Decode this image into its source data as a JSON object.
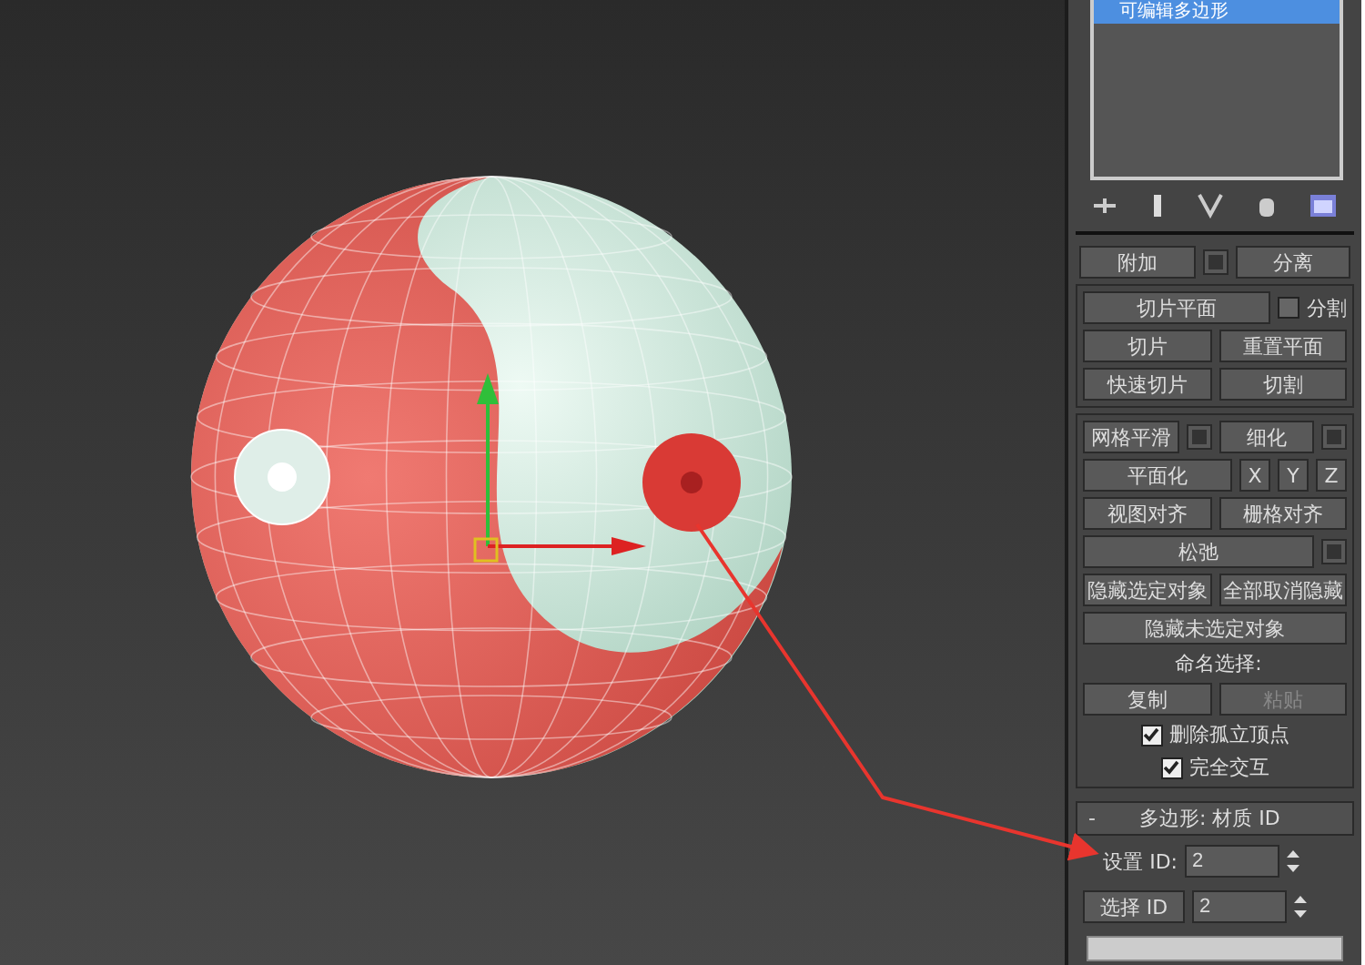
{
  "modifier_stack": {
    "items": [
      {
        "label": "可编辑多边形",
        "selected": true
      }
    ]
  },
  "sections": [
    {
      "boxed": false,
      "rows": [
        [
          {
            "kind": "button",
            "label": "附加",
            "settings": true
          },
          {
            "kind": "button",
            "label": "分离",
            "settings": false
          }
        ]
      ]
    },
    {
      "boxed": true,
      "rows": [
        [
          {
            "kind": "button",
            "label": "切片平面",
            "settings": false
          },
          {
            "kind": "checkbox",
            "label": "分割",
            "checked": false
          }
        ],
        [
          {
            "kind": "button",
            "label": "切片",
            "settings": false
          },
          {
            "kind": "button",
            "label": "重置平面",
            "settings": false
          }
        ],
        [
          {
            "kind": "button",
            "label": "快速切片",
            "settings": false
          },
          {
            "kind": "button",
            "label": "切割",
            "settings": false
          }
        ]
      ]
    },
    {
      "boxed": true,
      "rows": [
        [
          {
            "kind": "button",
            "label": "网格平滑",
            "settings": true
          },
          {
            "kind": "button",
            "label": "细化",
            "settings": true
          }
        ],
        [
          {
            "kind": "button",
            "label": "平面化",
            "settings": false
          },
          {
            "kind": "axis",
            "label": "X"
          },
          {
            "kind": "axis",
            "label": "Y"
          },
          {
            "kind": "axis",
            "label": "Z"
          }
        ],
        [
          {
            "kind": "button",
            "label": "视图对齐",
            "settings": false
          },
          {
            "kind": "button",
            "label": "栅格对齐",
            "settings": false
          }
        ],
        [
          {
            "kind": "button",
            "label": "松弛",
            "settings": true
          }
        ],
        [
          {
            "kind": "button",
            "label": "隐藏选定对象",
            "settings": false
          },
          {
            "kind": "button",
            "label": "全部取消隐藏",
            "settings": false
          }
        ],
        [
          {
            "kind": "button",
            "label": "隐藏未选定对象",
            "settings": false
          }
        ],
        [
          {
            "kind": "label",
            "label": "命名选择:"
          }
        ],
        [
          {
            "kind": "button",
            "label": "复制",
            "settings": false
          },
          {
            "kind": "button",
            "label": "粘贴",
            "settings": false,
            "disabled": true
          }
        ],
        [
          {
            "kind": "checkbox",
            "label": "删除孤立顶点",
            "checked": true
          }
        ],
        [
          {
            "kind": "checkbox",
            "label": "完全交互",
            "checked": true
          }
        ]
      ]
    }
  ],
  "rollout": {
    "toggle": "-",
    "title": "多边形: 材质 ID",
    "set_id": {
      "label": "设置 ID:",
      "value": "2"
    },
    "select_id": {
      "label": "选择 ID",
      "value": "2"
    }
  }
}
